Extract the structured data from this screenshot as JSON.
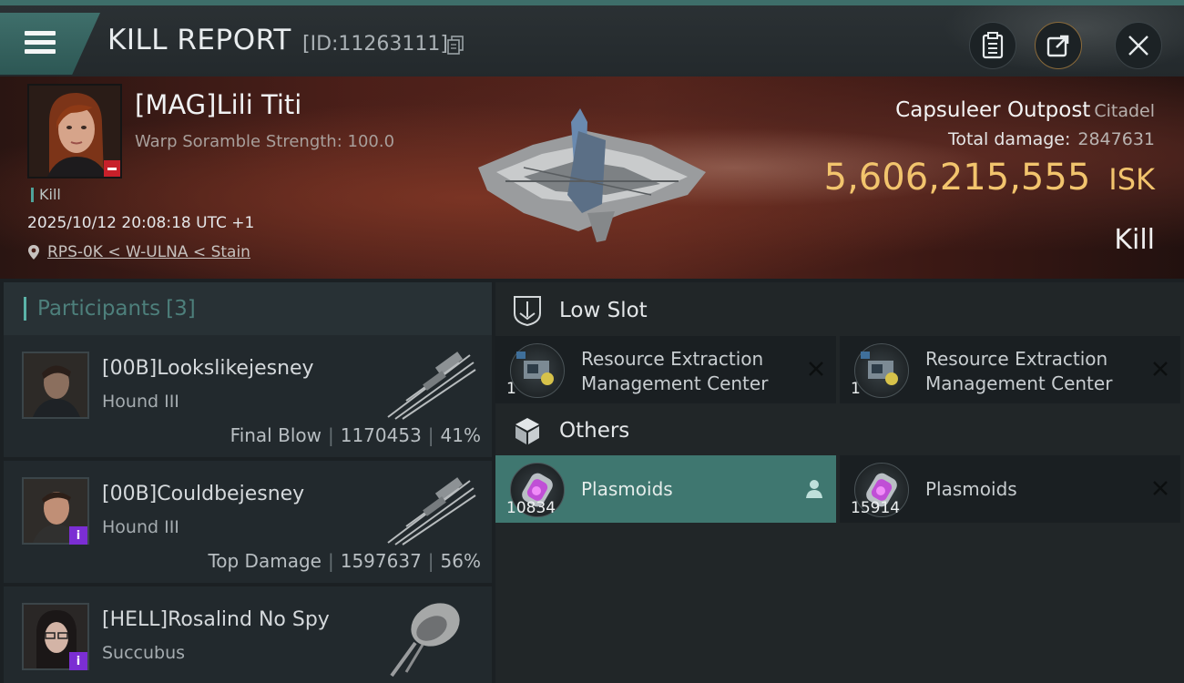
{
  "header": {
    "title": "KILL REPORT",
    "report_id": "[ID:11263111]"
  },
  "victim": {
    "name": "[MAG]Lili Titi",
    "stat_line": "Warp Soramble Strength: 100.0",
    "tag": "Kill",
    "datetime": "2025/10/12 20:08:18 UTC +1",
    "location": "RPS-0K < W-ULNA < Stain",
    "structure_name": "Capsuleer Outpost",
    "structure_class": "Citadel",
    "total_damage_label": "Total damage:",
    "total_damage_value": "2847631",
    "isk_amount": "5,606,215,555",
    "isk_unit": "ISK",
    "result_label": "Kill"
  },
  "participants": {
    "label": "Participants",
    "count": "[3]",
    "rows": [
      {
        "name": "[00B]Lookslikejesney",
        "ship": "Hound III",
        "role": "Final Blow",
        "damage": "1170453",
        "percent": "41%"
      },
      {
        "name": "[00B]Couldbejesney",
        "ship": "Hound III",
        "role": "Top Damage",
        "damage": "1597637",
        "percent": "56%"
      },
      {
        "name": "[HELL]Rosalind No Spy",
        "ship": "Succubus"
      }
    ]
  },
  "low_slot": {
    "title": "Low Slot",
    "items": [
      {
        "name_line1": "Resource Extraction",
        "name_line2": "Management Center",
        "qty": "1"
      },
      {
        "name_line1": "Resource Extraction",
        "name_line2": "Management Center",
        "qty": "1"
      }
    ]
  },
  "others": {
    "title": "Others",
    "items": [
      {
        "name": "Plasmoids",
        "qty": "10834"
      },
      {
        "name": "Plasmoids",
        "qty": "15914"
      }
    ]
  },
  "colors": {
    "accent_teal": "#3f7770",
    "isk_gold": "#f2c46d",
    "badge_purple": "#7b2ed3",
    "badge_red": "#c8202a"
  }
}
